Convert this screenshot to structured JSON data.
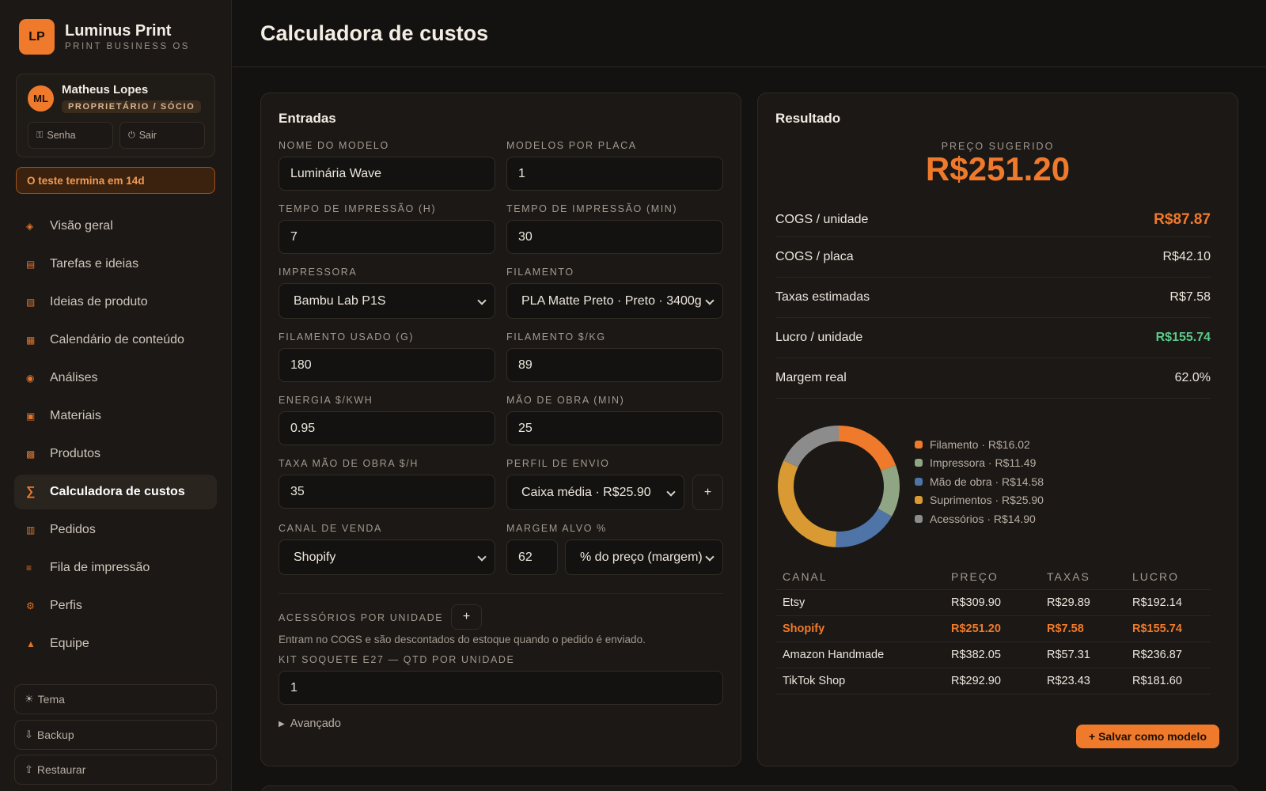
{
  "brand": {
    "initials": "LP",
    "name": "Luminus Print",
    "subtitle": "PRINT BUSINESS OS"
  },
  "user": {
    "initials": "ML",
    "name": "Matheus Lopes",
    "role": "PROPRIETÁRIO / SÓCIO",
    "password_label": "Senha",
    "logout_label": "Sair"
  },
  "trial": "O teste termina em 14d",
  "nav": [
    {
      "label": "Visão geral",
      "icon": "diamond-icon"
    },
    {
      "label": "Tarefas e ideias",
      "icon": "tasks-icon"
    },
    {
      "label": "Ideias de produto",
      "icon": "ideas-icon"
    },
    {
      "label": "Calendário de conteúdo",
      "icon": "calendar-icon"
    },
    {
      "label": "Análises",
      "icon": "analytics-icon"
    },
    {
      "label": "Materiais",
      "icon": "materials-icon"
    },
    {
      "label": "Produtos",
      "icon": "products-icon"
    },
    {
      "label": "Calculadora de custos",
      "icon": "sigma-icon"
    },
    {
      "label": "Pedidos",
      "icon": "orders-icon"
    },
    {
      "label": "Fila de impressão",
      "icon": "queue-icon"
    },
    {
      "label": "Perfis",
      "icon": "profiles-icon"
    },
    {
      "label": "Equipe",
      "icon": "team-icon"
    }
  ],
  "bottom": {
    "theme": "Tema",
    "backup": "Backup",
    "restore": "Restaurar"
  },
  "page_title": "Calculadora de custos",
  "inputs": {
    "title": "Entradas",
    "model_name_label": "NOME DO MODELO",
    "model_name": "Luminária Wave",
    "models_per_plate_label": "MODELOS POR PLACA",
    "models_per_plate": "1",
    "print_time_h_label": "TEMPO DE IMPRESSÃO (H)",
    "print_time_h": "7",
    "print_time_min_label": "TEMPO DE IMPRESSÃO (MIN)",
    "print_time_min": "30",
    "printer_label": "IMPRESSORA",
    "printer": "Bambu Lab P1S",
    "filament_label": "FILAMENTO",
    "filament": "PLA Matte Preto · Preto · 3400g",
    "filament_used_label": "FILAMENTO USADO (G)",
    "filament_used": "180",
    "filament_cost_label": "FILAMENTO $/KG",
    "filament_cost": "89",
    "energy_label": "ENERGIA $/KWH",
    "energy": "0.95",
    "labor_min_label": "MÃO DE OBRA (MIN)",
    "labor_min": "25",
    "labor_rate_label": "TAXA MÃO DE OBRA $/H",
    "labor_rate": "35",
    "shipping_label": "PERFIL DE ENVIO",
    "shipping": "Caixa média · R$25.90",
    "channel_label": "CANAL DE VENDA",
    "channel": "Shopify",
    "target_margin_label": "MARGEM ALVO %",
    "target_margin": "62",
    "margin_mode": "% do preço (margem)",
    "accessories_label": "ACESSÓRIOS POR UNIDADE",
    "accessories_hint": "Entram no COGS e são descontados do estoque quando o pedido é enviado.",
    "accessory_item_label": "KIT SOQUETE E27 — QTD POR UNIDADE",
    "accessory_item_qty": "1",
    "advanced_label": "Avançado",
    "plus": "+"
  },
  "result": {
    "title": "Resultado",
    "suggested_label": "PREÇO SUGERIDO",
    "suggested_price": "R$251.20",
    "rows": [
      {
        "label": "COGS / unidade",
        "value": "R$87.87",
        "color": "#f07a2b"
      },
      {
        "label": "COGS / placa",
        "value": "R$42.10",
        "color": "#ece6dd"
      },
      {
        "label": "Taxas estimadas",
        "value": "R$7.58",
        "color": "#ece6dd"
      },
      {
        "label": "Lucro / unidade",
        "value": "R$155.74",
        "color": "#5cc98a"
      },
      {
        "label": "Margem real",
        "value": "62.0%",
        "color": "#ece6dd"
      }
    ],
    "save_label": "+ Salvar como modelo"
  },
  "chart_data": {
    "type": "pie",
    "donut": true,
    "categories": [
      "Filamento",
      "Impressora",
      "Mão de obra",
      "Suprimentos",
      "Acessórios"
    ],
    "values": [
      16.02,
      11.49,
      14.58,
      25.9,
      14.9
    ],
    "labels": [
      "Filamento · R$16.02",
      "Impressora · R$11.49",
      "Mão de obra · R$14.58",
      "Suprimentos · R$25.90",
      "Acessórios · R$14.90"
    ],
    "colors": [
      "#f07a2b",
      "#8fa583",
      "#4f74a8",
      "#d99a33",
      "#8c8c8c"
    ],
    "legend": "right"
  },
  "channels": {
    "headers": [
      "CANAL",
      "PREÇO",
      "TAXAS",
      "LUCRO"
    ],
    "rows": [
      [
        "Etsy",
        "R$309.90",
        "R$29.89",
        "R$192.14"
      ],
      [
        "Shopify",
        "R$251.20",
        "R$7.58",
        "R$155.74"
      ],
      [
        "Amazon Handmade",
        "R$382.05",
        "R$57.31",
        "R$236.87"
      ],
      [
        "TikTok Shop",
        "R$292.90",
        "R$23.43",
        "R$181.60"
      ]
    ],
    "highlighted": "Shopify"
  }
}
